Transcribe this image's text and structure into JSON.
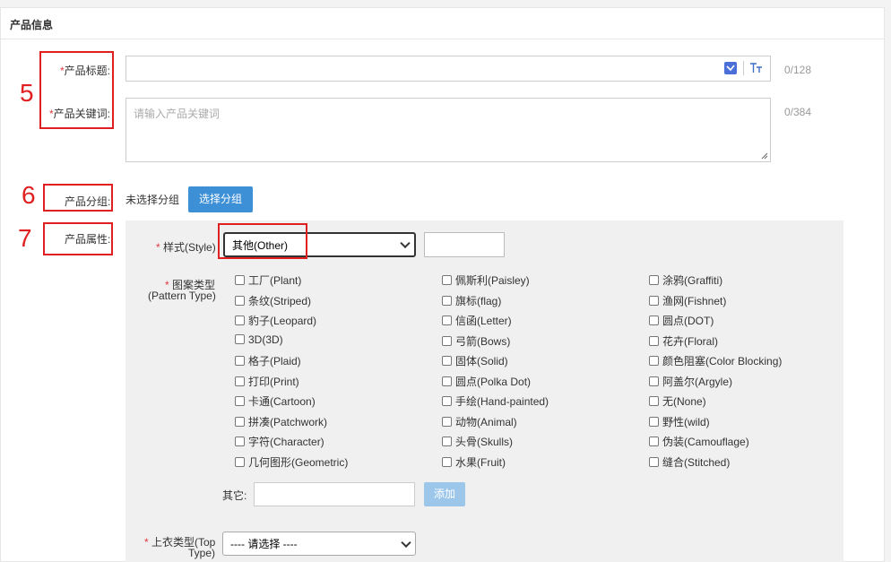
{
  "panel": {
    "title": "产品信息"
  },
  "markers": {
    "m5": "5",
    "m6": "6",
    "m7": "7"
  },
  "fields": {
    "title_req": "*",
    "title_label": "产品标题:",
    "title_counter": "0/128",
    "keywords_req": "*",
    "keywords_label": "产品关键词:",
    "keywords_placeholder": "请输入产品关键词",
    "keywords_counter": "0/384",
    "group_label": "产品分组:",
    "group_value": "未选择分组",
    "group_button": "选择分组",
    "attr_label": "产品属性:"
  },
  "attributes": {
    "style_req": "*",
    "style_label": "样式(Style)",
    "style_selected": "其他(Other)",
    "pattern_req": "*",
    "pattern_label_1": "图案类型",
    "pattern_label_2": "(Pattern Type)",
    "pattern_options": [
      [
        "工厂(Plant)",
        "佩斯利(Paisley)",
        "涂鸦(Graffiti)"
      ],
      [
        "条纹(Striped)",
        "旗标(flag)",
        "渔网(Fishnet)"
      ],
      [
        "豹子(Leopard)",
        "信函(Letter)",
        "圆点(DOT)"
      ],
      [
        "3D(3D)",
        "弓箭(Bows)",
        "花卉(Floral)"
      ],
      [
        "格子(Plaid)",
        "固体(Solid)",
        "颜色阻塞(Color Blocking)"
      ],
      [
        "打印(Print)",
        "圆点(Polka Dot)",
        "阿盖尔(Argyle)"
      ],
      [
        "卡通(Cartoon)",
        "手绘(Hand-painted)",
        "无(None)"
      ],
      [
        "拼凑(Patchwork)",
        "动物(Animal)",
        "野性(wild)"
      ],
      [
        "字符(Character)",
        "头骨(Skulls)",
        "伪装(Camouflage)"
      ],
      [
        "几何图形(Geometric)",
        "水果(Fruit)",
        "缝合(Stitched)"
      ]
    ],
    "other_label": "其它:",
    "add_button": "添加",
    "top_type_req": "*",
    "top_type_label_1": "上衣类型(Top",
    "top_type_label_2": "Type)",
    "top_type_selected": "---- 请选择 ----"
  },
  "colors": {
    "accent": "#3d8fd6",
    "required": "#e4393c",
    "annotation": "#e02020"
  }
}
